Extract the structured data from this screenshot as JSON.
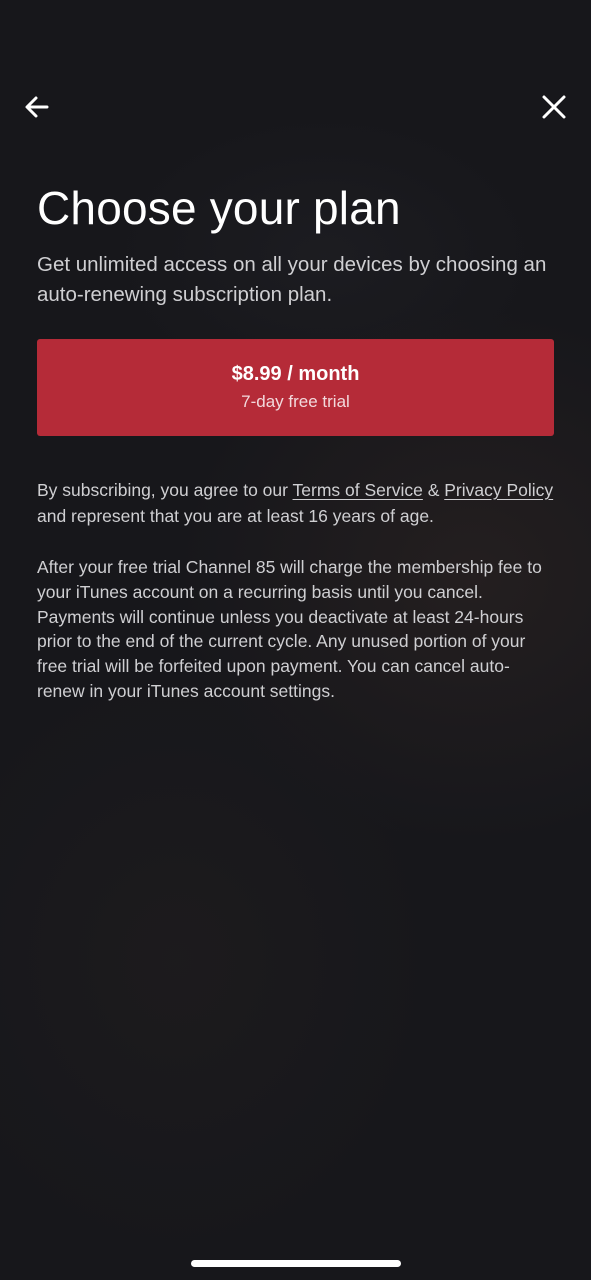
{
  "header": {
    "back_icon": "arrow-left-icon",
    "close_icon": "close-icon"
  },
  "main": {
    "title": "Choose your plan",
    "subtitle": "Get unlimited access on all your devices by choosing an auto-renewing subscription plan.",
    "plan": {
      "price": "$8.99 / month",
      "trial": "7-day free trial",
      "accent_color": "#b52b38"
    },
    "terms": {
      "prefix": "By subscribing, you agree to our ",
      "tos_link": "Terms of Service",
      "amp": " & ",
      "privacy_link": "Privacy Policy",
      "suffix": " and represent that you are at least 16 years of age."
    },
    "disclaimer": "After your free trial Channel 85 will charge the membership fee to your iTunes account on a recurring basis until you cancel. Payments will continue unless you deactivate at least 24-hours prior to the end of the current cycle. Any unused portion of your free trial will be forfeited upon payment. You can cancel auto-renew in your iTunes account settings."
  }
}
